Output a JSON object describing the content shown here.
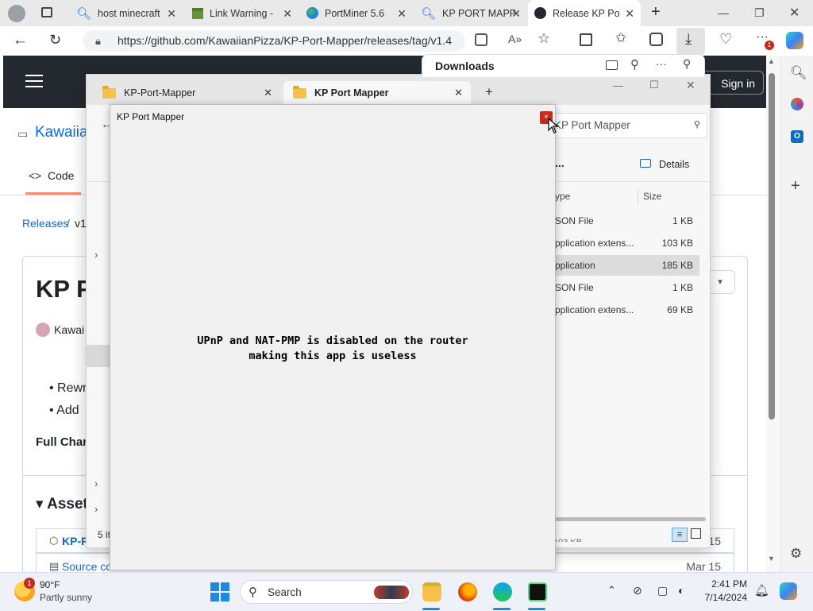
{
  "browser": {
    "tabs": [
      {
        "title": "host minecraft",
        "icon": "search-icon"
      },
      {
        "title": "Link Warning -",
        "icon": "minecraft-block-icon"
      },
      {
        "title": "PortMiner 5.6",
        "icon": "globe-icon"
      },
      {
        "title": "KP PORT MAPP",
        "icon": "search-icon"
      },
      {
        "title": "Release KP Po",
        "icon": "github-icon"
      }
    ],
    "url": "https://github.com/KawaiianPizza/KP-Port-Mapper/releases/tag/v1.4",
    "download_badge": "1"
  },
  "github": {
    "sign_in": "Sign in",
    "repo_owner": "Kawaiia",
    "nav_code": "Code",
    "breadcrumb_releases": "Releases",
    "breadcrumb_sep": "/",
    "breadcrumb_tag": "v1",
    "release_title": "KP P",
    "author": "Kawai",
    "bullets": [
      "Rewr",
      "Add"
    ],
    "full_changelog": "Full Char",
    "assets_heading": "Asset",
    "asset_rows": [
      {
        "name": "KP-P",
        "date": "Mar 15"
      },
      {
        "name": "Source co",
        "date": "Mar 15"
      }
    ]
  },
  "downloads": {
    "title": "Downloads"
  },
  "explorer": {
    "tabs": [
      {
        "label": "KP-Port-Mapper",
        "active": false
      },
      {
        "label": "KP Port Mapper",
        "active": true
      }
    ],
    "new_tab": "+",
    "search_label": "KP Port Mapper",
    "details_label": "Details",
    "more": "...",
    "col_type": "ype",
    "col_size": "Size",
    "files": [
      {
        "type": "SON File",
        "size": "1 KB",
        "selected": false
      },
      {
        "type": "pplication extens...",
        "size": "103 KB",
        "selected": false
      },
      {
        "type": "pplication",
        "size": "185 KB",
        "selected": true
      },
      {
        "type": "SON File",
        "size": "1 KB",
        "selected": false
      },
      {
        "type": "pplication extens...",
        "size": "69 KB",
        "selected": false
      }
    ],
    "status_items": "5 it",
    "partial_size": "103 KB"
  },
  "dialog": {
    "title": "KP Port Mapper",
    "close": "×",
    "message_line1": "UPnP and NAT-PMP is disabled on the router",
    "message_line2": "making this app is useless"
  },
  "taskbar": {
    "weather_temp": "90°F",
    "weather_desc": "Partly sunny",
    "weather_badge": "1",
    "search_placeholder": "Search",
    "time": "2:41 PM",
    "date": "7/14/2024"
  },
  "colors": {
    "github_header": "#24292f",
    "dialog_close": "#c42b1c",
    "link_blue": "#0969da"
  }
}
